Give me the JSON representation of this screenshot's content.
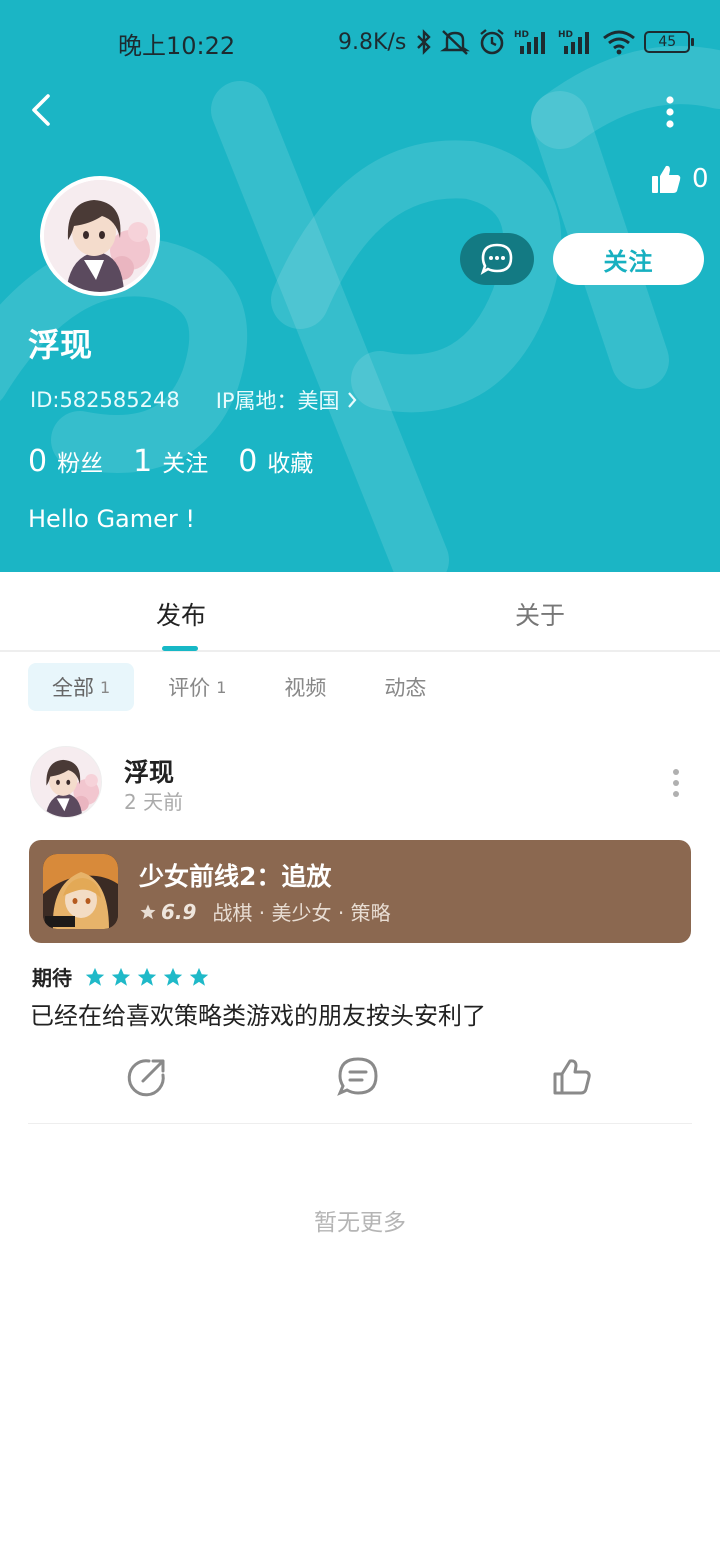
{
  "status_bar": {
    "time": "晚上10:22",
    "speed": "9.8K/s",
    "battery": "45"
  },
  "profile": {
    "likes": "0",
    "name": "浮现",
    "id": "ID:582585248",
    "ip": "IP属地：美国",
    "follow_label": "关注",
    "bio": "Hello Gamer !",
    "stats": [
      {
        "num": "0",
        "label": "粉丝"
      },
      {
        "num": "1",
        "label": "关注"
      },
      {
        "num": "0",
        "label": "收藏"
      }
    ]
  },
  "tabs": [
    {
      "label": "发布",
      "active": true
    },
    {
      "label": "关于",
      "active": false
    }
  ],
  "filters": [
    {
      "label": "全部",
      "count": "1",
      "active": true
    },
    {
      "label": "评价",
      "count": "1",
      "active": false
    },
    {
      "label": "视频",
      "count": "",
      "active": false
    },
    {
      "label": "动态",
      "count": "",
      "active": false
    }
  ],
  "post": {
    "author": "浮现",
    "time": "2 天前",
    "game": {
      "title": "少女前线2：追放",
      "score": "6.9",
      "tags": "战棋 · 美少女 · 策略"
    },
    "rating_label": "期待",
    "stars": 5,
    "text": "已经在给喜欢策略类游戏的朋友按头安利了"
  },
  "footer": {
    "no_more": "暂无更多"
  },
  "colors": {
    "header_bg": "#1bb5c5",
    "accent": "#17b8c6",
    "game_card_bg": "#8b6850",
    "message_button": "#137a83"
  }
}
